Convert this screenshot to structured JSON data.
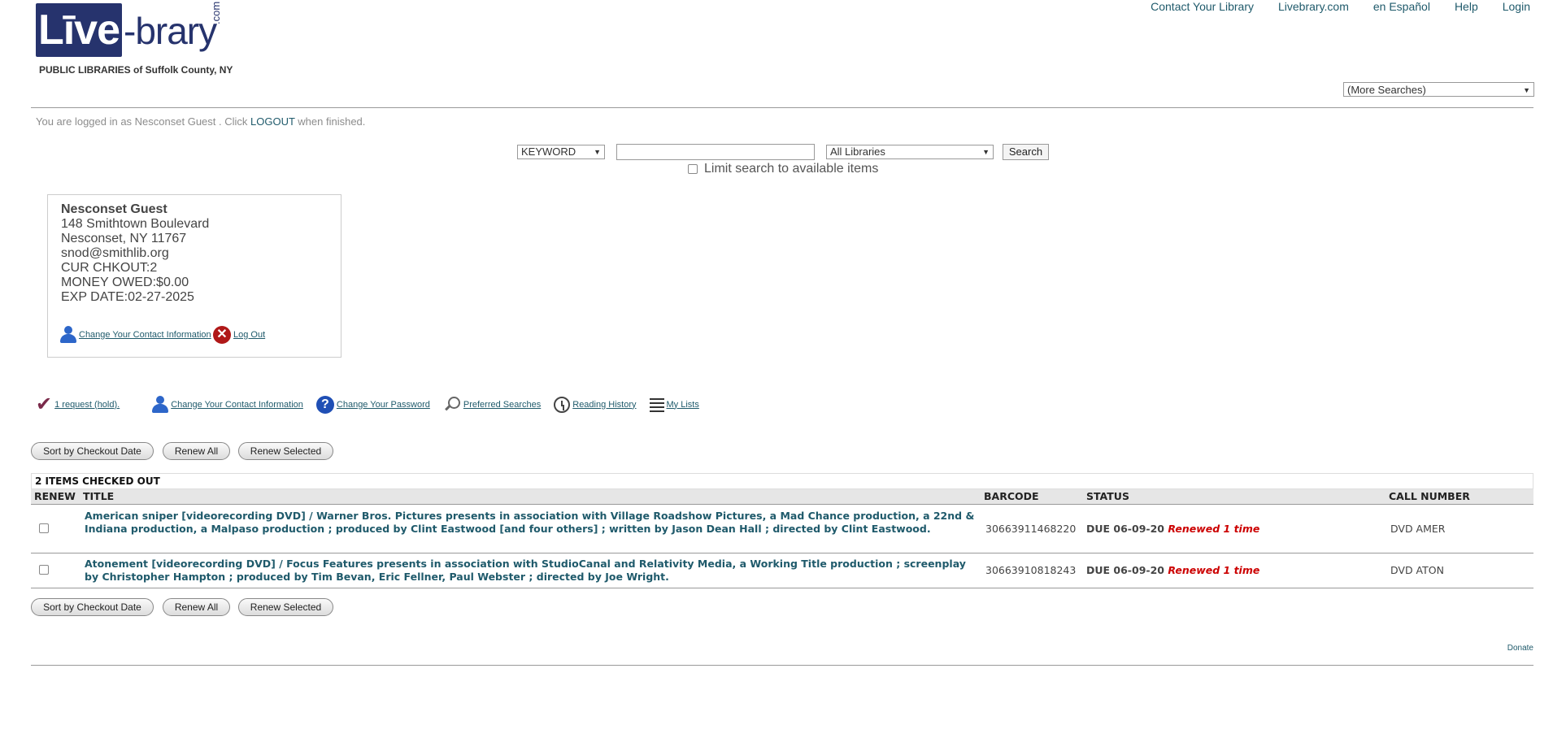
{
  "logo": {
    "mark": "Līve",
    "rest": "-brary",
    "com": ".com",
    "subtitle": "PUBLIC LIBRARIES of Suffolk County, NY"
  },
  "topnav": [
    "Contact Your Library",
    "Livebrary.com",
    "en Español",
    "Help",
    "Login"
  ],
  "more_searches": "(More Searches)",
  "login_message": {
    "prefix": "You are logged in as Nesconset Guest . Click ",
    "link": "LOGOUT",
    "suffix": " when finished."
  },
  "search": {
    "type_selected": "KEYWORD",
    "query": "",
    "library_selected": "All Libraries",
    "button": "Search",
    "limit_label": "Limit search to available items"
  },
  "patron": {
    "name": "Nesconset Guest",
    "address1": "148 Smithtown Boulevard",
    "address2": "Nesconset, NY 11767",
    "email": "snod@smithlib.org",
    "checkouts": "CUR CHKOUT:2",
    "money_owed": "MONEY OWED:$0.00",
    "exp_date": "EXP DATE:02-27-2025",
    "change_contact": "Change Your Contact Information",
    "logout": "Log Out"
  },
  "actions": {
    "requests": "1 request (hold).",
    "change_contact": "Change Your Contact Information",
    "change_password": "Change Your Password",
    "preferred_searches": "Preferred Searches",
    "reading_history": "Reading History",
    "my_lists": "My Lists"
  },
  "buttons": {
    "sort": "Sort by Checkout Date",
    "renew_all": "Renew All",
    "renew_selected": "Renew Selected"
  },
  "checkouts": {
    "caption": "2 ITEMS CHECKED OUT",
    "headers": {
      "renew": "RENEW",
      "title": "TITLE",
      "barcode": "BARCODE",
      "status": "STATUS",
      "call_number": "CALL NUMBER"
    },
    "rows": [
      {
        "title": "American sniper [videorecording DVD] / Warner Bros. Pictures presents in association with Village Roadshow Pictures, a Mad Chance production, a 22nd & Indiana production, a Malpaso production ; produced by Clint Eastwood [and four others] ; written by Jason Dean Hall ; directed by Clint Eastwood.",
        "barcode": "30663911468220",
        "due": "DUE 06-09-20",
        "renewed": "Renewed 1 time",
        "call_number": "DVD AMER"
      },
      {
        "title": "Atonement [videorecording DVD] / Focus Features presents in association with StudioCanal and Relativity Media, a Working Title production ; screenplay by Christopher Hampton ; produced by Tim Bevan, Eric Fellner, Paul Webster ; directed by Joe Wright.",
        "barcode": "30663910818243",
        "due": "DUE 06-09-20",
        "renewed": "Renewed 1 time",
        "call_number": "DVD ATON"
      }
    ]
  },
  "footer": {
    "donate": "Donate"
  }
}
